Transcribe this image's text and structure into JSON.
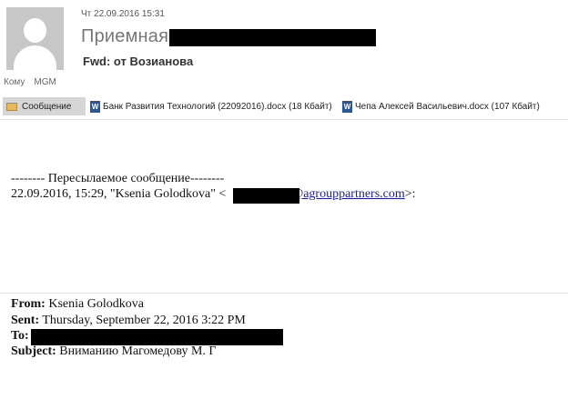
{
  "header": {
    "date": "Чт 22.09.2016 15:31",
    "sender_name": "Приемная",
    "subject": "Fwd: от Возианова",
    "to_label": "Кому",
    "to_value": "MGM"
  },
  "attachments": {
    "message_tab": "Сообщение",
    "files": [
      {
        "name": "Банк Развития Технологий (22092016).docx (18 Кбайт)"
      },
      {
        "name": "Чепа Алексей Васильевич.docx (107 Кбайт)"
      }
    ]
  },
  "body": {
    "forward_header": "-------- Пересылаемое сообщение--------",
    "forward_line_prefix": "22.09.2016, 15:29, \"Ksenia Golodkova\" <",
    "email_domain": "@agrouppartners.com",
    "forward_line_suffix": ">:",
    "from_label": "From:",
    "from_value": "Ksenia Golodkova",
    "sent_label": "Sent:",
    "sent_value": "Thursday, September 22, 2016 3:22 PM",
    "to_label": "To:",
    "subject_label": "Subject:",
    "subject_value": "Вниманию Магомедову М. Г"
  },
  "icons": {
    "avatar": "person-silhouette-icon",
    "message": "envelope-icon",
    "word_doc": "word-document-icon"
  }
}
